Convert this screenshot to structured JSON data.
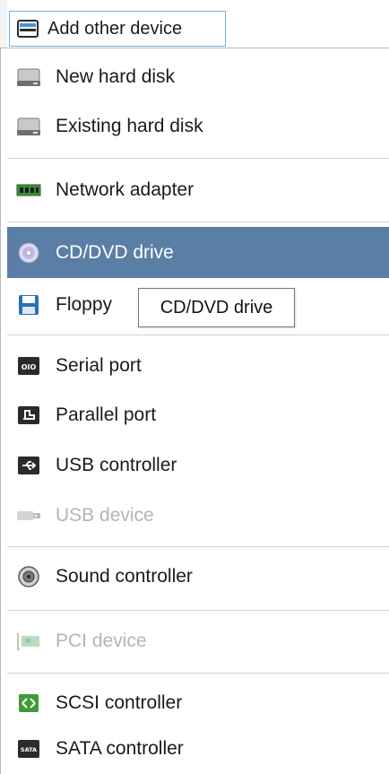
{
  "toolbar": {
    "add_button_label": "Add other device",
    "add_button_icon": "device-icon"
  },
  "menu": {
    "items": [
      {
        "label": "New hard disk",
        "icon": "hard-disk-icon",
        "enabled": true,
        "selected": false
      },
      {
        "label": "Existing hard disk",
        "icon": "hard-disk-icon",
        "enabled": true,
        "selected": false
      },
      {
        "label": "Network adapter",
        "icon": "network-adapter-icon",
        "enabled": true,
        "selected": false
      },
      {
        "label": "CD/DVD drive",
        "icon": "cd-dvd-icon",
        "enabled": true,
        "selected": true
      },
      {
        "label": "Floppy",
        "icon": "floppy-icon",
        "enabled": true,
        "selected": false
      },
      {
        "label": "Serial port",
        "icon": "serial-port-icon",
        "enabled": true,
        "selected": false
      },
      {
        "label": "Parallel port",
        "icon": "parallel-port-icon",
        "enabled": true,
        "selected": false
      },
      {
        "label": "USB controller",
        "icon": "usb-controller-icon",
        "enabled": true,
        "selected": false
      },
      {
        "label": "USB device",
        "icon": "usb-device-icon",
        "enabled": false,
        "selected": false
      },
      {
        "label": "Sound controller",
        "icon": "sound-controller-icon",
        "enabled": true,
        "selected": false
      },
      {
        "label": "PCI device",
        "icon": "pci-device-icon",
        "enabled": false,
        "selected": false
      },
      {
        "label": "SCSI controller",
        "icon": "scsi-controller-icon",
        "enabled": true,
        "selected": false
      },
      {
        "label": "SATA controller",
        "icon": "sata-controller-icon",
        "enabled": true,
        "selected": false
      }
    ]
  },
  "tooltip": {
    "text": "CD/DVD drive"
  },
  "colors": {
    "selected_background": "#5a7ea6",
    "button_border": "#6fb3e6",
    "disabled_text": "#b4b4b4"
  }
}
